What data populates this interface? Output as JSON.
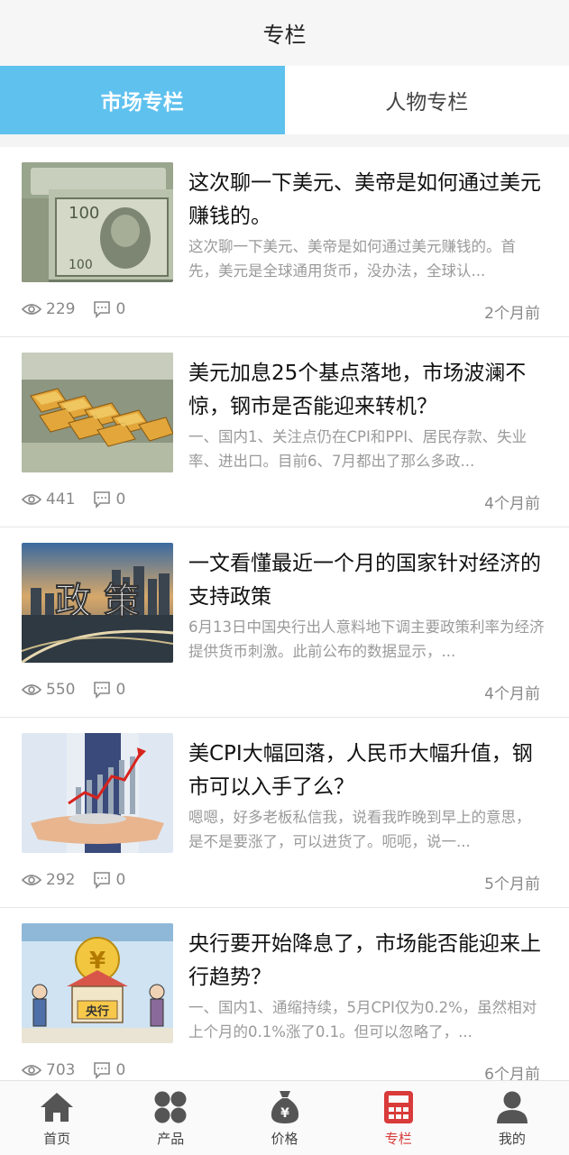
{
  "header": {
    "title": "专栏"
  },
  "tabs": [
    {
      "label": "市场专栏",
      "active": true
    },
    {
      "label": "人物专栏",
      "active": false
    }
  ],
  "articles": [
    {
      "title": "这次聊一下美元、美帝是如何通过美元赚钱的。",
      "summary": "这次聊一下美元、美帝是如何通过美元赚钱的。首先，美元是全球通用货币，没办法，全球认...",
      "views": "229",
      "comments": "0",
      "time": "2个月前",
      "thumb": "dollar-bills-image"
    },
    {
      "title": "美元加息25个基点落地，市场波澜不惊，钢市是否能迎来转机？",
      "summary": "一、国内1、关注点仍在CPI和PPI、居民存款、失业率、进出口。目前6、7月都出了那么多政...",
      "views": "441",
      "comments": "0",
      "time": "4个月前",
      "thumb": "gold-bars-image"
    },
    {
      "title": "一文看懂最近一个月的国家针对经济的支持政策",
      "summary": "6月13日中国央行出人意料地下调主要政策利率为经济提供货币刺激。此前公布的数据显示，...",
      "views": "550",
      "comments": "0",
      "time": "4个月前",
      "thumb": "policy-city-image",
      "thumb_text": "政 策"
    },
    {
      "title": "美CPI大幅回落，人民币大幅升值，钢市可以入手了么？",
      "summary": "嗯嗯，好多老板私信我，说看我昨晚到早上的意思，是不是要涨了，可以进货了。呃呃，说一...",
      "views": "292",
      "comments": "0",
      "time": "5个月前",
      "thumb": "rising-chart-hands-image"
    },
    {
      "title": "央行要开始降息了，市场能否能迎来上行趋势？",
      "summary": "一、国内1、通缩持续，5月CPI仅为0.2%，虽然相对上个月的0.1%涨了0.1。但可以忽略了，...",
      "views": "703",
      "comments": "0",
      "time": "6个月前",
      "thumb": "central-bank-cartoon-image",
      "thumb_text": "央行"
    }
  ],
  "tabbar": [
    {
      "label": "首页",
      "icon": "home-icon",
      "active": false
    },
    {
      "label": "产品",
      "icon": "grid-icon",
      "active": false
    },
    {
      "label": "价格",
      "icon": "money-bag-icon",
      "active": false
    },
    {
      "label": "专栏",
      "icon": "calculator-icon",
      "active": true
    },
    {
      "label": "我的",
      "icon": "user-icon",
      "active": false
    }
  ],
  "colors": {
    "accent": "#5fc1ee",
    "active_tab": "#d93a3a",
    "muted": "#9a9a9a"
  }
}
